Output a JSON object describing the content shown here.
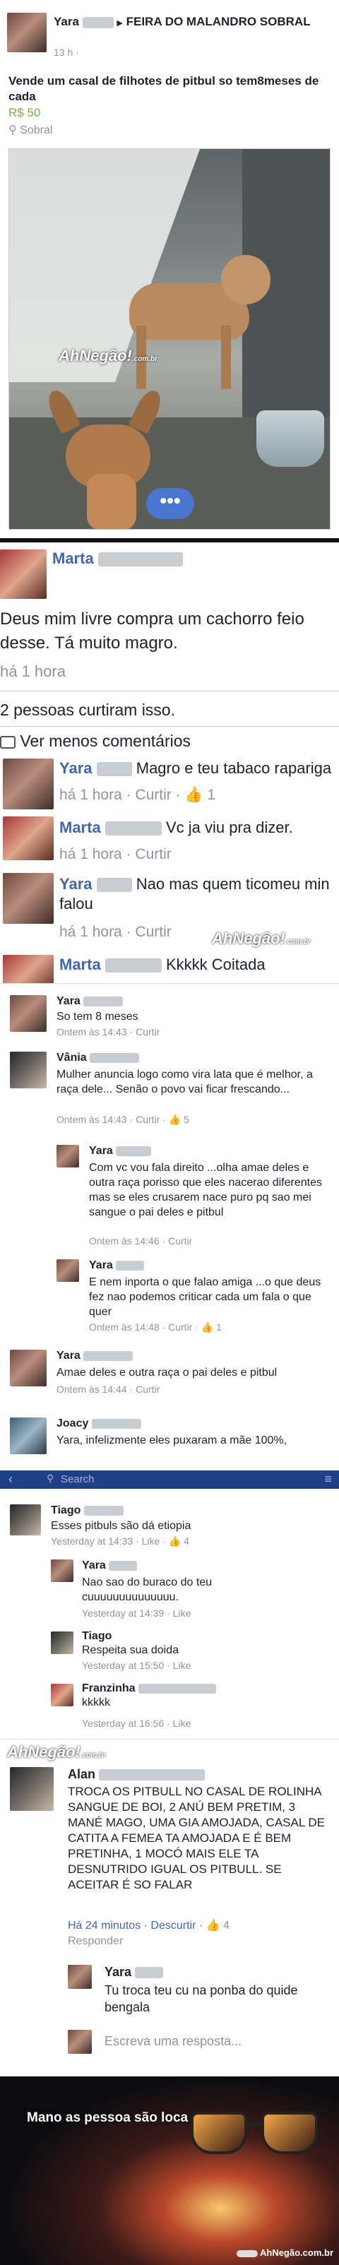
{
  "post": {
    "author": "Yara",
    "arrow": "▶",
    "group": "FEIRA DO MALANDRO SOBRAL",
    "time": "13 h",
    "text": "Vende um casal de filhotes de pitbul so tem8meses de cada",
    "price": "R$ 50",
    "location": "Sobral",
    "watermark": "AhNegão!",
    "watermark_sub": ".com.br"
  },
  "comments1": {
    "main": {
      "name": "Marta",
      "text": "Deus mim livre compra um cachorro feio desse. Tá muito magro.",
      "time": "há 1 hora"
    },
    "likes_line": "2 pessoas curtiram isso.",
    "see_less": "Ver menos comentários",
    "replies": [
      {
        "name": "Yara",
        "text": "Magro e teu tabaco raparigа",
        "meta": "há 1 hora · Curtir ·",
        "likes": "1"
      },
      {
        "name": "Marta",
        "text": "Vc ja viu pra dizer.",
        "meta": "há 1 hora · Curtir"
      },
      {
        "name": "Yara",
        "text": "Nao mas quem ticomeu min falou",
        "meta": "há 1 hora · Curtir"
      },
      {
        "name": "Marta",
        "text": "Kkkkk Coitada"
      }
    ]
  },
  "comments2": {
    "items": [
      {
        "name": "Yara",
        "text": "So tem 8 meses",
        "time": "Ontem às 14:43",
        "action": "Curtir"
      },
      {
        "name": "Vânia",
        "text": "Mulher anuncia logo como vira lata que é melhor, a raça dele... Senão o povo vai ficar frescando...",
        "time": "Ontem às 14:43",
        "action": "Curtir",
        "likes": "5"
      },
      {
        "name": "Yara",
        "text": "Com vc vou fala direito ...olha amae deles e outra raça porisso que eles nacerao diferentes mas se eles crusarem nace puro pq sao mei sangue o pai deles e pitbul",
        "time": "Ontem às 14:46",
        "action": "Curtir"
      },
      {
        "name": "Yara",
        "text": "E nem inporta o que falao amiga ...o que deus fez nao podemos criticar cada um fala o que quer",
        "time": "Ontem às 14:48",
        "action": "Curtir",
        "likes": "1"
      },
      {
        "name": "Yara",
        "text": "Amae deles e outra raça o pai deles e pitbul",
        "time": "Ontem às 14:44",
        "action": "Curtir"
      },
      {
        "name": "Joacy",
        "text": "Yara, infelizmente eles puxaram a mãe 100%,"
      }
    ]
  },
  "comments3": {
    "search_placeholder": "Search",
    "items": [
      {
        "name": "Tiago",
        "text": "Esses pitbuls são dá etiopia",
        "meta": "Yesterday at 14:33 · Like ·",
        "likes": "4"
      },
      {
        "name": "Yara",
        "text": "Nao sao do buraco do teu cuuuuuuuuuuuuuu.",
        "meta": "Yesterday at 14:39 · Like"
      },
      {
        "name": "Tiago",
        "text": "Respeita sua doida",
        "meta": "Yesterday at 15:50 · Like"
      },
      {
        "name": "Franzinha",
        "text": "kkkkk",
        "meta": "Yesterday at 16:56 · Like"
      }
    ]
  },
  "comments4": {
    "main": {
      "name": "Alan",
      "text": "TROCA OS PITBULL NO CASAL DE ROLINHA SANGUE DE BOI, 2 ANÚ BEM PRETIM, 3 MANÉ MAGO, UMA GIA AMOJADA, CASAL DE CATITA A FEMEA TA AMOJADA E É BEM PRETINHA, 1 MOCÓ MAIS ELE TA DESNUTRIDO IGUAL OS PITBULL. SE ACEITAR É SO FALAR",
      "meta": "Há 24 minutos · Descurtir ·",
      "likes": "4",
      "reply": "Responder"
    },
    "reply": {
      "name": "Yara",
      "text": "Tu troca teu cu na ponba do quide bengala"
    },
    "compose_placeholder": "Escreva uma resposta..."
  },
  "footer": {
    "caption": "Mano as pessoa são loca",
    "site": "AhNegão.com.br"
  }
}
